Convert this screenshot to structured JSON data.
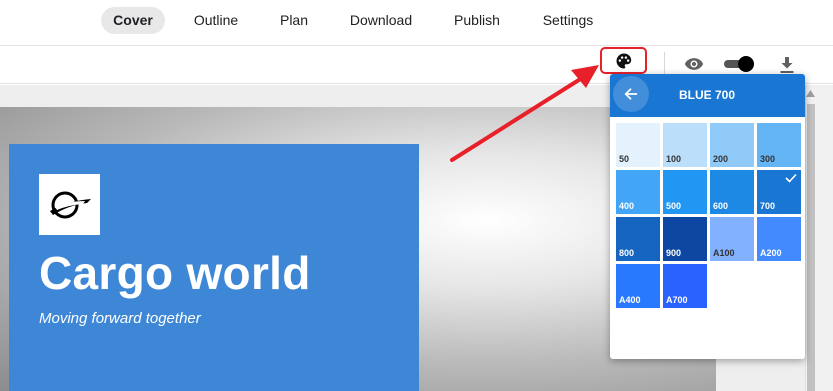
{
  "tabs": [
    {
      "label": "Cover",
      "active": true
    },
    {
      "label": "Outline",
      "active": false
    },
    {
      "label": "Plan",
      "active": false
    },
    {
      "label": "Download",
      "active": false
    },
    {
      "label": "Publish",
      "active": false
    },
    {
      "label": "Settings",
      "active": false
    }
  ],
  "toolbar": {
    "palette_icon": "palette-icon",
    "preview_icon": "eye-icon",
    "toggle_on": true,
    "download_icon": "download-icon"
  },
  "cover": {
    "title": "Cargo world",
    "subtitle": "Moving forward together",
    "card_color": "#3d87d6",
    "logo_icon": "airplane-globe-logo"
  },
  "color_picker": {
    "title": "BLUE 700",
    "header_color": "#1976d2",
    "back_icon": "arrow-left-icon",
    "selected": "700",
    "swatches": [
      {
        "label": "50",
        "color": "#e3f2fd"
      },
      {
        "label": "100",
        "color": "#bbdefb"
      },
      {
        "label": "200",
        "color": "#90caf9"
      },
      {
        "label": "300",
        "color": "#64b5f6"
      },
      {
        "label": "400",
        "color": "#42a5f5"
      },
      {
        "label": "500",
        "color": "#2196f3"
      },
      {
        "label": "600",
        "color": "#1e88e5"
      },
      {
        "label": "700",
        "color": "#1976d2"
      },
      {
        "label": "800",
        "color": "#1565c0"
      },
      {
        "label": "900",
        "color": "#0d47a1"
      },
      {
        "label": "A100",
        "color": "#82b1ff"
      },
      {
        "label": "A200",
        "color": "#448aff"
      },
      {
        "label": "A400",
        "color": "#2979ff"
      },
      {
        "label": "A700",
        "color": "#2962ff"
      }
    ]
  },
  "annotation": {
    "color": "#e8202a"
  }
}
